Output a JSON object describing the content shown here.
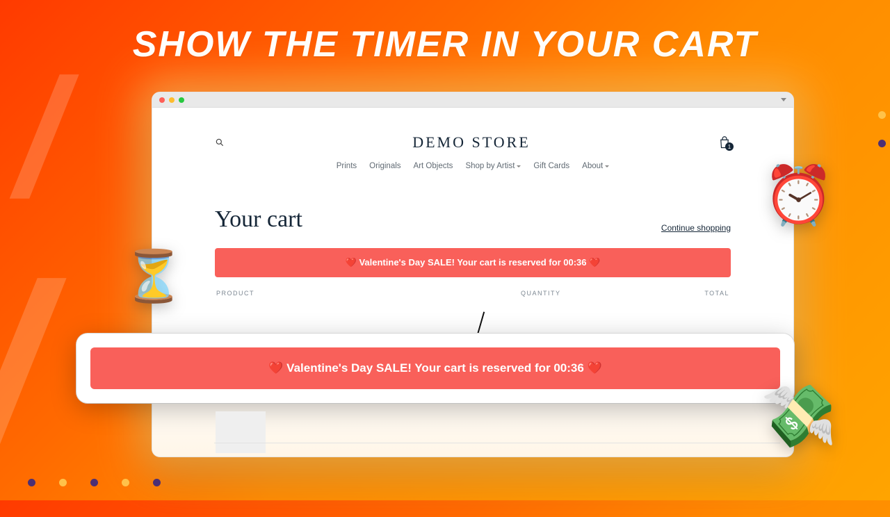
{
  "headline": "SHOW THE TIMER IN YOUR CART",
  "store": {
    "brand": "DEMO STORE",
    "cart_count": "1",
    "nav": {
      "prints": "Prints",
      "originals": "Originals",
      "art_objects": "Art Objects",
      "shop_by_artist": "Shop by Artist",
      "gift_cards": "Gift Cards",
      "about": "About"
    },
    "cart_title": "Your cart",
    "continue_shopping": "Continue shopping",
    "banner_text": "❤️ Valentine's Day SALE! Your cart is reserved for 00:36 ❤️",
    "columns": {
      "product": "PRODUCT",
      "quantity": "QUANTITY",
      "total": "TOTAL"
    }
  },
  "callout": {
    "banner_text": "❤️ Valentine's Day SALE! Your cart is reserved for 00:36 ❤️"
  },
  "emoji": {
    "hourglass": "⏳",
    "alarm": "⏰",
    "money": "💸"
  }
}
